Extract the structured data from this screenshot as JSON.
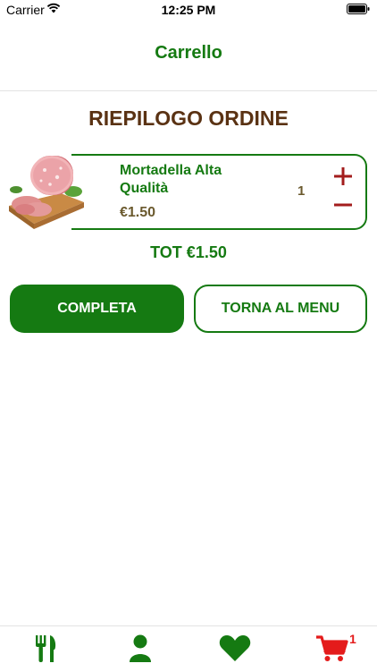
{
  "status_bar": {
    "carrier": "Carrier",
    "time": "12:25 PM"
  },
  "header": {
    "title": "Carrello"
  },
  "main": {
    "section_title": "RIEPILOGO ORDINE",
    "cart_items": [
      {
        "name": "Mortadella Alta Qualità",
        "price": "€1.50",
        "quantity": "1",
        "image_icon": "mortadella-image"
      }
    ],
    "total": "TOT €1.50",
    "buttons": {
      "complete": "COMPLETA",
      "back_to_menu": "TORNA AL MENU"
    }
  },
  "tab_bar": {
    "items": [
      {
        "icon": "fork-knife-icon"
      },
      {
        "icon": "user-icon"
      },
      {
        "icon": "heart-icon"
      },
      {
        "icon": "cart-icon"
      }
    ],
    "cart_badge": "1"
  },
  "colors": {
    "primary_green": "#157a12",
    "title_brown": "#5a3213",
    "price_brown": "#6b5a2e",
    "accent_red": "#e41b1b"
  }
}
